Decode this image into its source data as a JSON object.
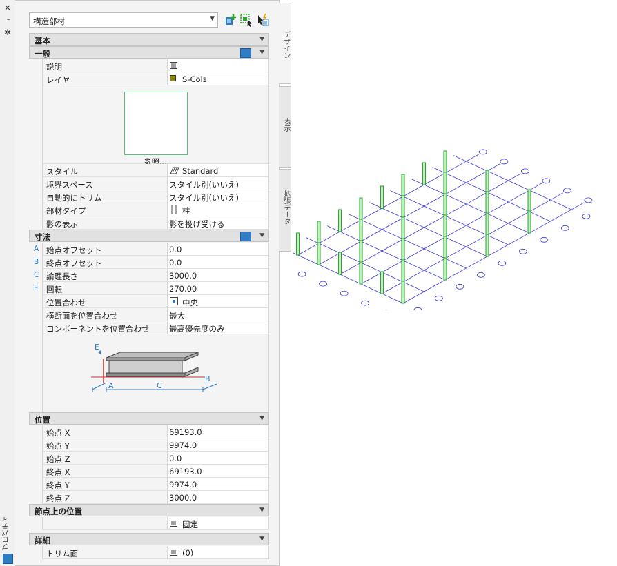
{
  "strip": {
    "title": "プロパティ",
    "close_icon": "×",
    "pin_icon": "ı–",
    "settings_icon": "✲"
  },
  "selector": {
    "value": "構造部材"
  },
  "tabs": [
    {
      "label": "デザイン"
    },
    {
      "label": "表示"
    },
    {
      "label": "拡張データ"
    }
  ],
  "categories": {
    "basic": "基本",
    "general": "一般",
    "dimensions": "寸法",
    "location": "位置",
    "node_location": "節点上の位置",
    "details": "詳細"
  },
  "general": {
    "description": {
      "label": "説明"
    },
    "layer": {
      "label": "レイヤ",
      "value": "S-Cols",
      "swatch": "#8a8a00"
    },
    "browse_label": "参照...",
    "style": {
      "label": "スタイル",
      "value": "Standard"
    },
    "boundary_space": {
      "label": "境界スペース",
      "value": "スタイル別(いいえ)"
    },
    "auto_trim": {
      "label": "自動的にトリム",
      "value": "スタイル別(いいえ)"
    },
    "member_type": {
      "label": "部材タイプ",
      "value": "柱"
    },
    "shadow": {
      "label": "影の表示",
      "value": "影を投げ受ける"
    }
  },
  "dimensions": {
    "start_offset": {
      "letter": "A",
      "label": "始点オフセット",
      "value": "0.0"
    },
    "end_offset": {
      "letter": "B",
      "label": "終点オフセット",
      "value": "0.0"
    },
    "logical_length": {
      "letter": "C",
      "label": "論理長さ",
      "value": "3000.0"
    },
    "rotation": {
      "letter": "E",
      "label": "回転",
      "value": "270.00"
    },
    "justify": {
      "label": "位置合わせ",
      "value": "中央"
    },
    "justify_cross": {
      "label": "横断面を位置合わせ",
      "value": "最大"
    },
    "justify_comp": {
      "label": "コンポーネントを位置合わせ",
      "value": "最高優先度のみ"
    },
    "diagram_labels": {
      "e": "E",
      "a": "A",
      "c": "C",
      "b": "B"
    }
  },
  "location": {
    "start_x": {
      "label": "始点 X",
      "value": "69193.0"
    },
    "start_y": {
      "label": "始点 Y",
      "value": "9974.0"
    },
    "start_z": {
      "label": "始点 Z",
      "value": "0.0"
    },
    "end_x": {
      "label": "終点 X",
      "value": "69193.0"
    },
    "end_y": {
      "label": "終点 Y",
      "value": "9974.0"
    },
    "end_z": {
      "label": "終点 Z",
      "value": "3000.0"
    }
  },
  "node_location": {
    "value": "固定"
  },
  "details": {
    "trim_planes": {
      "label": "トリム面",
      "value": "(0)"
    }
  },
  "colors": {
    "accent": "#2f7dc4",
    "column": "#2aa52a",
    "grid_line": "#3a3ad8"
  }
}
